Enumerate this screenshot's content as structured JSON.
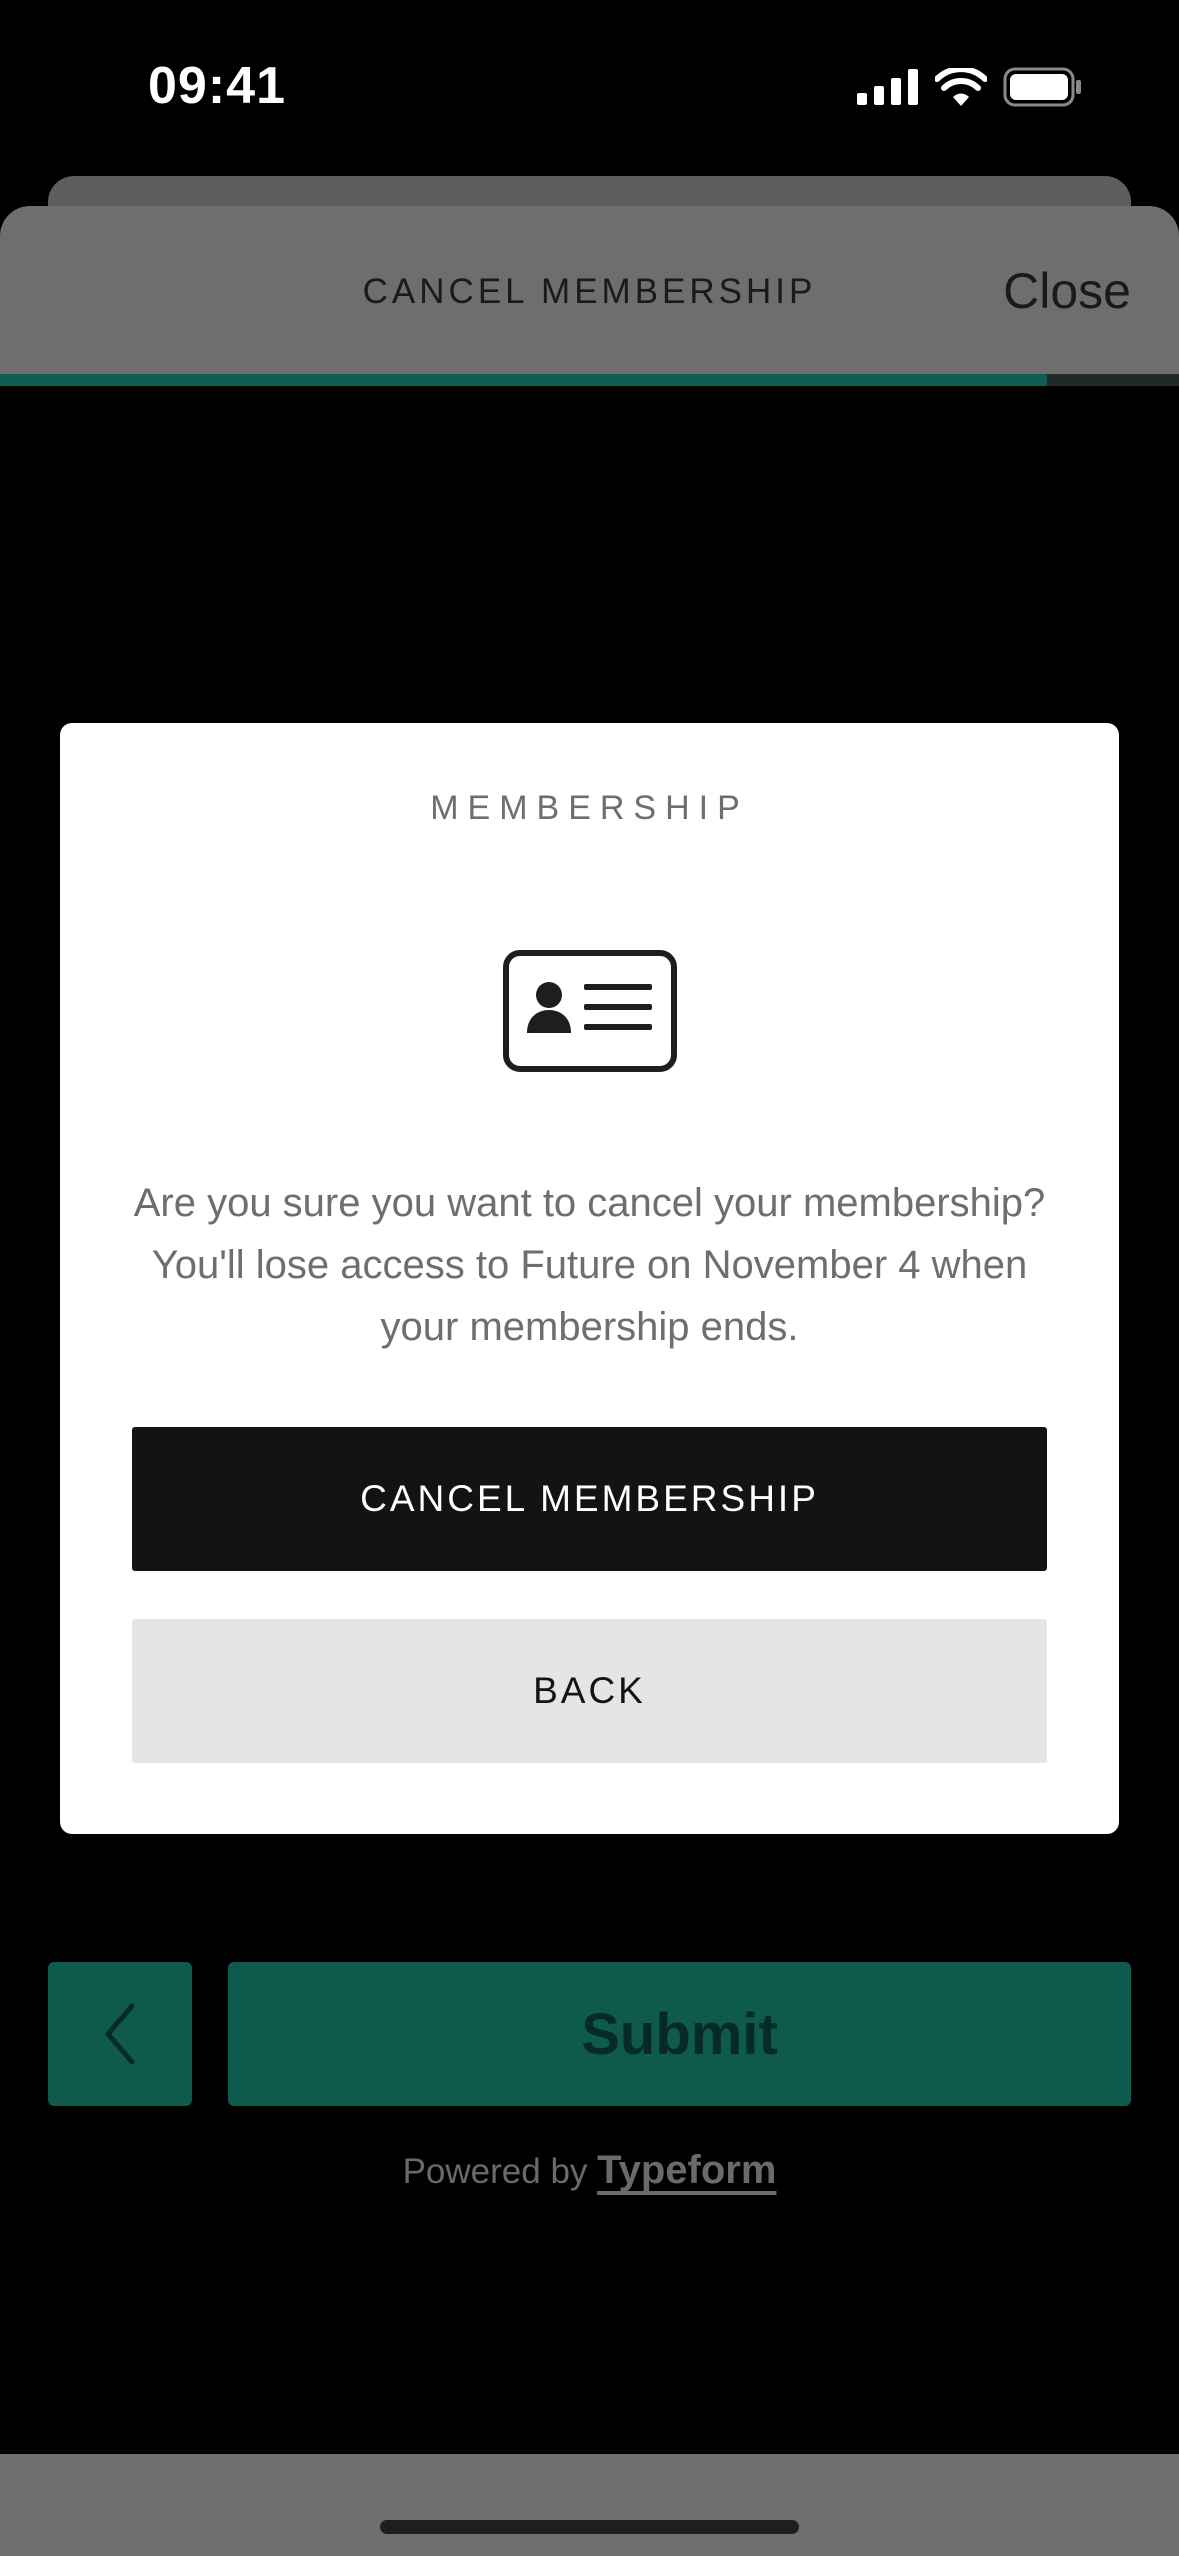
{
  "status_bar": {
    "time": "09:41",
    "icons": [
      "signal-icon",
      "wifi-icon",
      "battery-icon"
    ]
  },
  "sheet": {
    "title": "CANCEL MEMBERSHIP",
    "close_label": "Close",
    "progress_fraction": 0.888
  },
  "modal": {
    "title": "MEMBERSHIP",
    "icon": "membership-card-icon",
    "message": "Are you sure you want to cancel your membership? You'll lose access to Future on November 4 when your membership ends.",
    "confirm_label": "CANCEL MEMBERSHIP",
    "back_label": "BACK"
  },
  "footer": {
    "back_icon": "chevron-left-icon",
    "submit_label": "Submit",
    "powered_prefix": "Powered by",
    "powered_brand": "Typeform"
  },
  "colors": {
    "accent": "#0e5a4d",
    "confirm_button": "#121315",
    "back_button": "#e5e5e7"
  }
}
